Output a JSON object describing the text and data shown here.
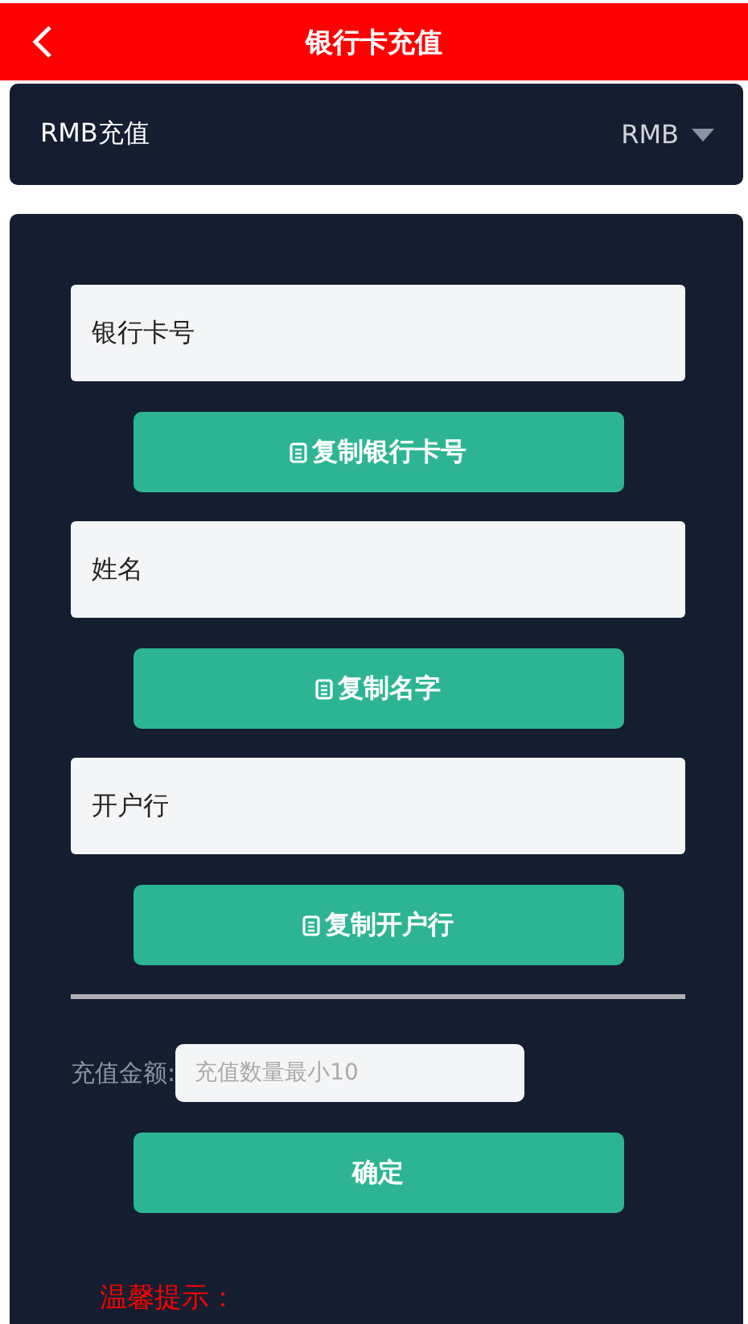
{
  "header": {
    "title": "银行卡充值"
  },
  "currency_bar": {
    "label": "RMB充值",
    "selected_currency": "RMB"
  },
  "info_fields": [
    {
      "value": "银行卡号",
      "copy_button": "复制银行卡号"
    },
    {
      "value": "姓名",
      "copy_button": "复制名字"
    },
    {
      "value": "开户行",
      "copy_button": "复制开户行"
    }
  ],
  "amount": {
    "label": "充值金额:",
    "placeholder": "充值数量最小10"
  },
  "confirm_button": "确定",
  "tips_title": "温馨提示："
}
